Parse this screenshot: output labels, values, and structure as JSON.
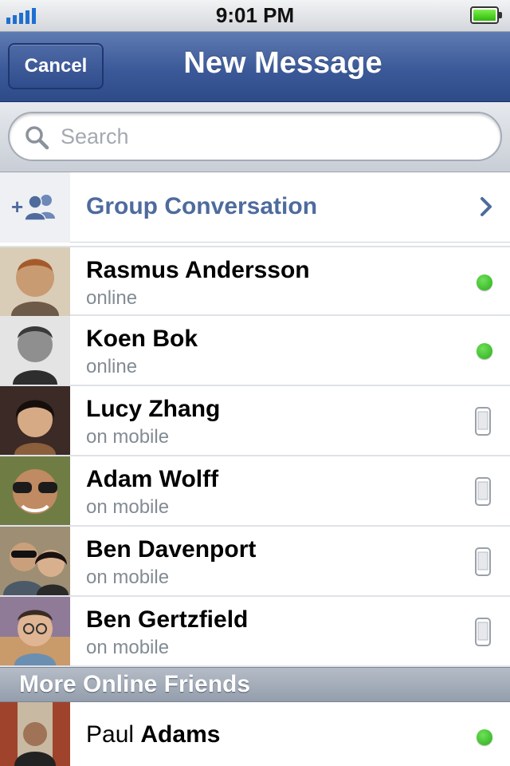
{
  "status_bar": {
    "time": "9:01 PM",
    "signal_bars": 5,
    "battery_level": 1.0
  },
  "nav": {
    "cancel_label": "Cancel",
    "title": "New Message"
  },
  "search": {
    "placeholder": "Search",
    "icon": "search-icon"
  },
  "group": {
    "label": "Group Conversation",
    "icon": "group-add-icon",
    "chevron": "chevron-right-icon"
  },
  "friends": [
    {
      "name": "Rasmus Andersson",
      "status": "online",
      "indicator": "online-dot",
      "avatar_color": "#b68a63"
    },
    {
      "name": "Koen Bok",
      "status": "online",
      "indicator": "online-dot",
      "avatar_color": "#7d7a77"
    },
    {
      "name": "Lucy Zhang",
      "status": "on mobile",
      "indicator": "mobile-icon",
      "avatar_color": "#3a2a25"
    },
    {
      "name": "Adam Wolff",
      "status": "on mobile",
      "indicator": "mobile-icon",
      "avatar_color": "#5d6b3a"
    },
    {
      "name": "Ben Davenport",
      "status": "on mobile",
      "indicator": "mobile-icon",
      "avatar_color": "#8a7b68"
    },
    {
      "name": "Ben Gertzfield",
      "status": "on mobile",
      "indicator": "mobile-icon",
      "avatar_color": "#7a6a86"
    }
  ],
  "more_section": {
    "title": "More Online Friends",
    "friend": {
      "first": "Paul",
      "last": "Adams",
      "indicator": "online-dot",
      "avatar_color": "#6f5a48"
    }
  },
  "colors": {
    "nav_blue": "#3b5998",
    "group_text": "#4e6b9d",
    "online_green": "#2aae1a",
    "status_gray": "#838b93"
  }
}
